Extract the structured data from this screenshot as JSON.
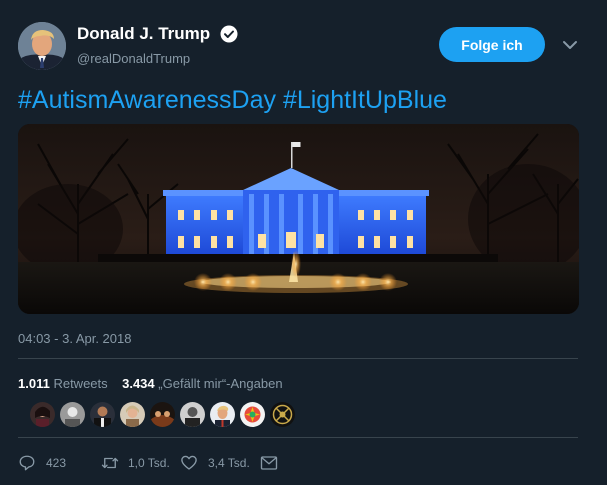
{
  "author": {
    "name": "Donald J. Trump",
    "handle": "@realDonaldTrump",
    "verified": true
  },
  "follow_button": "Folge ich",
  "tweet": {
    "hashtags": [
      "#AutismAwarenessDay",
      "#LightItUpBlue"
    ]
  },
  "timestamp": "04:03 - 3. Apr. 2018",
  "stats": {
    "retweets_count": "1.011",
    "retweets_label": "Retweets",
    "likes_count": "3.434",
    "likes_label": "„Gefällt mir“-Angaben"
  },
  "actions": {
    "replies": "423",
    "retweets": "1,0 Tsd.",
    "likes": "3,4 Tsd."
  },
  "colors": {
    "background": "#15202b",
    "accent": "#1da1f2",
    "secondary_text": "#8899a6",
    "divider": "#38444d"
  }
}
